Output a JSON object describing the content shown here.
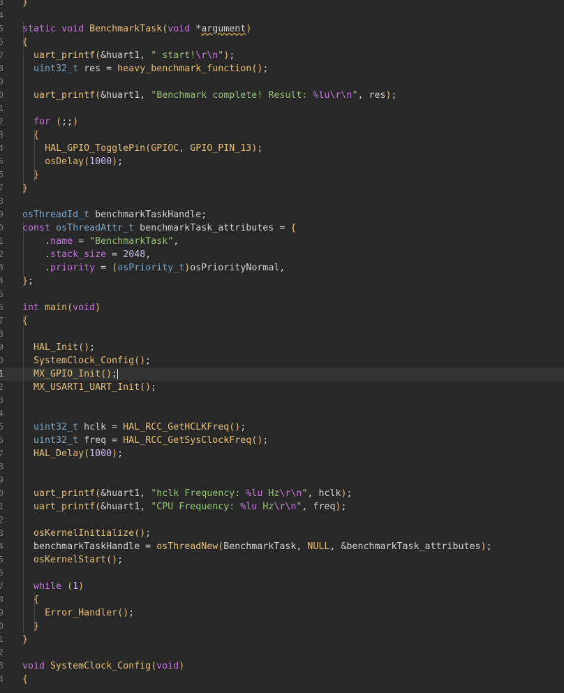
{
  "editor": {
    "colors": {
      "background": "#282828",
      "current_line": "#333333",
      "keyword": "#c678dd",
      "function": "#e5c07b",
      "type": "#7ea9c9",
      "string": "#98c379",
      "number": "#c7b9ea"
    },
    "lines": [
      {
        "number": "3",
        "text": "}"
      },
      {
        "number": "4",
        "text": ""
      },
      {
        "number": "5",
        "text": "static void BenchmarkTask(void *argument)"
      },
      {
        "number": "6",
        "text": "{"
      },
      {
        "number": "7",
        "text": "  uart_printf(&huart1, \" start!\\r\\n\");"
      },
      {
        "number": "8",
        "text": "  uint32_t res = heavy_benchmark_function();"
      },
      {
        "number": "9",
        "text": ""
      },
      {
        "number": "0",
        "text": "  uart_printf(&huart1, \"Benchmark complete! Result: %lu\\r\\n\", res);"
      },
      {
        "number": "1",
        "text": ""
      },
      {
        "number": "2",
        "text": "  for (;;)"
      },
      {
        "number": "3",
        "text": "  {"
      },
      {
        "number": "4",
        "text": "    HAL_GPIO_TogglePin(GPIOC, GPIO_PIN_13);"
      },
      {
        "number": "5",
        "text": "    osDelay(1000);"
      },
      {
        "number": "6",
        "text": "  }"
      },
      {
        "number": "7",
        "text": "}"
      },
      {
        "number": "8",
        "text": ""
      },
      {
        "number": "9",
        "text": "osThreadId_t benchmarkTaskHandle;"
      },
      {
        "number": "0",
        "text": "const osThreadAttr_t benchmarkTask_attributes = {"
      },
      {
        "number": "1",
        "text": "    .name = \"BenchmarkTask\","
      },
      {
        "number": "2",
        "text": "    .stack_size = 2048,"
      },
      {
        "number": "3",
        "text": "    .priority = (osPriority_t)osPriorityNormal,"
      },
      {
        "number": "4",
        "text": "};"
      },
      {
        "number": "5",
        "text": ""
      },
      {
        "number": "6",
        "text": "int main(void)"
      },
      {
        "number": "7",
        "text": "{"
      },
      {
        "number": "8",
        "text": ""
      },
      {
        "number": "9",
        "text": "  HAL_Init();"
      },
      {
        "number": "0",
        "text": "  SystemClock_Config();"
      },
      {
        "number": "1",
        "text": "  MX_GPIO_Init();"
      },
      {
        "number": "2",
        "text": "  MX_USART1_UART_Init();"
      },
      {
        "number": "3",
        "text": ""
      },
      {
        "number": "4",
        "text": ""
      },
      {
        "number": "5",
        "text": "  uint32_t hclk = HAL_RCC_GetHCLKFreq();"
      },
      {
        "number": "6",
        "text": "  uint32_t freq = HAL_RCC_GetSysClockFreq();"
      },
      {
        "number": "7",
        "text": "  HAL_Delay(1000);"
      },
      {
        "number": "8",
        "text": ""
      },
      {
        "number": "9",
        "text": ""
      },
      {
        "number": "0",
        "text": "  uart_printf(&huart1, \"hclk Frequency: %lu Hz\\r\\n\", hclk);"
      },
      {
        "number": "1",
        "text": "  uart_printf(&huart1, \"CPU Frequency: %lu Hz\\r\\n\", freq);"
      },
      {
        "number": "2",
        "text": ""
      },
      {
        "number": "3",
        "text": "  osKernelInitialize();"
      },
      {
        "number": "4",
        "text": "  benchmarkTaskHandle = osThreadNew(BenchmarkTask, NULL, &benchmarkTask_attributes);"
      },
      {
        "number": "5",
        "text": "  osKernelStart();"
      },
      {
        "number": "6",
        "text": ""
      },
      {
        "number": "7",
        "text": "  while (1)"
      },
      {
        "number": "8",
        "text": "  {"
      },
      {
        "number": "9",
        "text": "    Error_Handler();"
      },
      {
        "number": "0",
        "text": "  }"
      },
      {
        "number": "1",
        "text": "}"
      },
      {
        "number": "2",
        "text": ""
      },
      {
        "number": "3",
        "text": "void SystemClock_Config(void)"
      },
      {
        "number": "4",
        "text": "{"
      }
    ]
  }
}
